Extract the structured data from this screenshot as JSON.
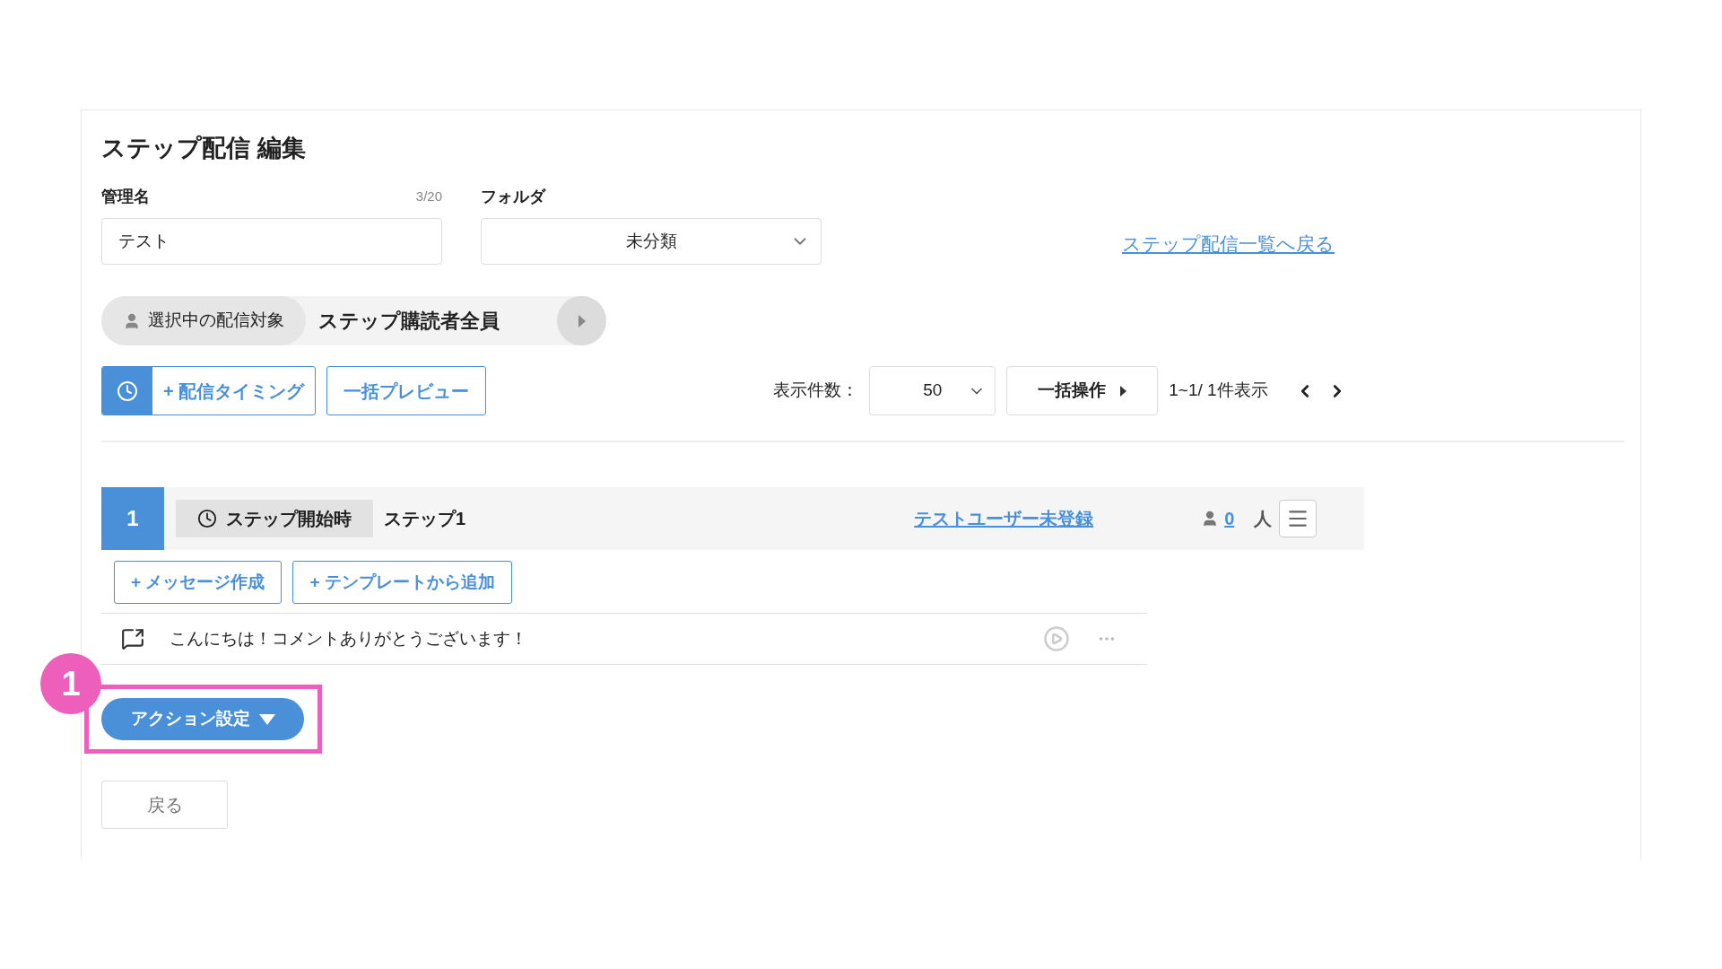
{
  "page": {
    "title": "ステップ配信 編集"
  },
  "form": {
    "name_label": "管理名",
    "name_counter": "3/20",
    "name_value": "テスト",
    "folder_label": "フォルダ",
    "folder_value": "未分類",
    "back_link": "ステップ配信一覧へ戻る"
  },
  "target": {
    "label": "選択中の配信対象",
    "value": "ステップ購読者全員"
  },
  "toolbar": {
    "timing_button": "+ 配信タイミング",
    "preview_button": "一括プレビュー",
    "per_page_label": "表示件数：",
    "per_page_value": "50",
    "bulk_button": "一括操作",
    "range": "1~1/ 1件表示"
  },
  "steps": [
    {
      "number": "1",
      "timing": "ステップ開始時",
      "name": "ステップ1",
      "test_user_link": "テストユーザー未登録",
      "count": "0",
      "count_unit": "人",
      "buttons": [
        "+ メッセージ作成",
        "+ テンプレートから追加"
      ],
      "messages": [
        {
          "text": "こんにちは！コメントありがとうございます！"
        }
      ]
    }
  ],
  "action_button": "アクション設定",
  "annotation": {
    "number": "1"
  },
  "back_button": "戻る"
}
